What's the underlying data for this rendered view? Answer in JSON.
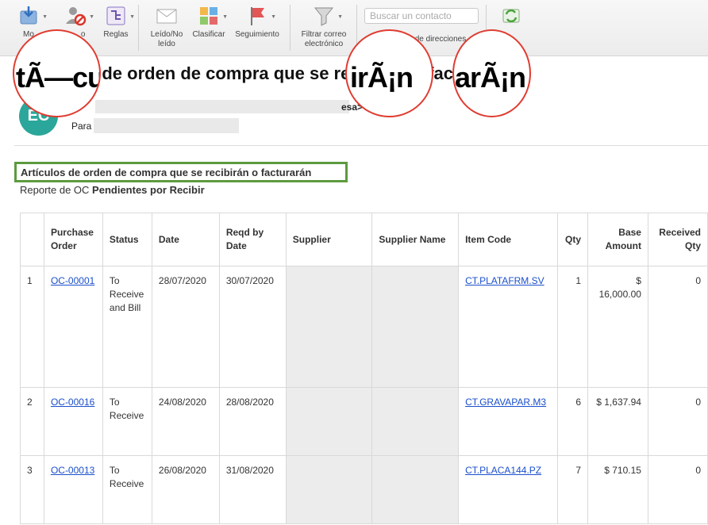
{
  "toolbar": {
    "move_label": "Mover",
    "junk_label": "Correo no deseado",
    "junk_visible": "Mo",
    "rules_label": "Reglas",
    "read_label_1": "Leído/No",
    "read_label_2": "leído",
    "classify_label": "Clasificar",
    "followup_label": "Seguimiento",
    "filter_label_1": "Filtrar correo",
    "filter_label_2": "electrónico",
    "search_placeholder": "Buscar un contacto",
    "addressbook_label": "de direcciones",
    "partial_label": "o"
  },
  "email": {
    "subject_rest": "s de orden de compra que se recibirán o facturarán",
    "avatar_initials": "EC",
    "from_tail": "esa",
    "to_label": "Para"
  },
  "circles": {
    "c1": "tÃ—cu",
    "c2": "irÃ¡n",
    "c3": "arÃ¡n"
  },
  "report": {
    "title": "Artículos de orden de compra que se recibirán o facturarán",
    "subtitle_prefix": "Reporte de OC ",
    "subtitle_bold": "Pendientes por Recibir"
  },
  "table": {
    "headers": [
      "",
      "Purchase Order",
      "Status",
      "Date",
      "Reqd by Date",
      "Supplier",
      "Supplier Name",
      "Item Code",
      "Qty",
      "Base Amount",
      "Received Qty"
    ],
    "rows": [
      {
        "idx": "1",
        "po": "OC-00001",
        "status": "To Receive and Bill",
        "date": "28/07/2020",
        "reqd": "30/07/2020",
        "item": "CT.PLATAFRM.SV",
        "qty": "1",
        "amount": "$ 16,000.00",
        "received": "0"
      },
      {
        "idx": "2",
        "po": "OC-00016",
        "status": "To Receive",
        "date": "24/08/2020",
        "reqd": "28/08/2020",
        "item": "CT.GRAVAPAR.M3",
        "qty": "6",
        "amount": "$ 1,637.94",
        "received": "0"
      },
      {
        "idx": "3",
        "po": "OC-00013",
        "status": "To Receive",
        "date": "26/08/2020",
        "reqd": "31/08/2020",
        "item": "CT.PLACA144.PZ",
        "qty": "7",
        "amount": "$ 710.15",
        "received": "0"
      }
    ]
  }
}
